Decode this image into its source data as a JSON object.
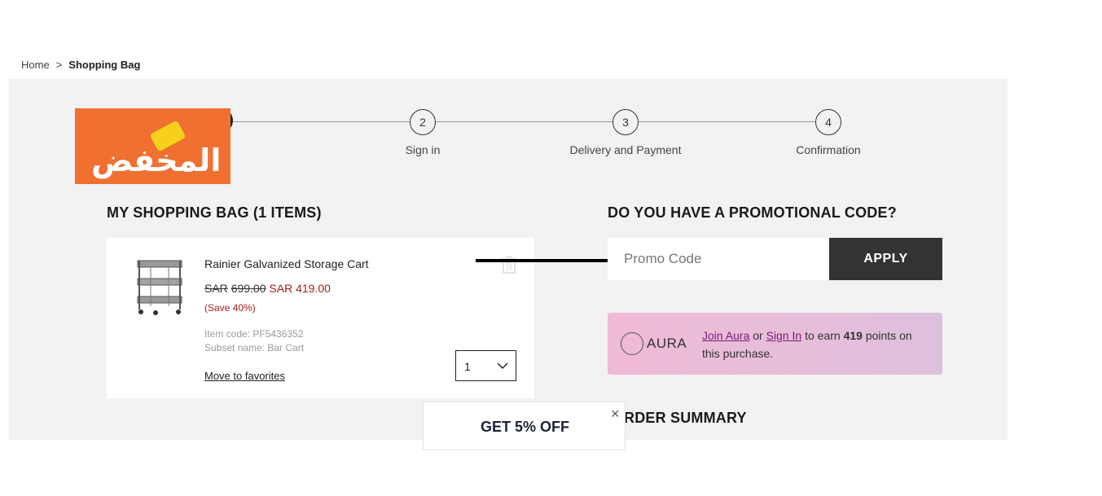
{
  "breadcrumb": {
    "home": "Home",
    "separator": ">",
    "current": "Shopping Bag"
  },
  "logo": {
    "text": "المخفض"
  },
  "steps": [
    {
      "number": "2",
      "label": "Sign in"
    },
    {
      "number": "3",
      "label": "Delivery and Payment"
    },
    {
      "number": "4",
      "label": "Confirmation"
    }
  ],
  "bag": {
    "title": "MY SHOPPING BAG (1 ITEMS)",
    "item": {
      "name": "Rainier Galvanized Storage Cart",
      "old_currency": "SAR",
      "old_price": "699.00",
      "new_currency": "SAR",
      "new_price": "419.00",
      "save": "(Save 40%)",
      "item_code": "Item code: PF5436352",
      "subset": "Subset name: Bar Cart",
      "move_to_favorites": "Move to favorites",
      "quantity": "1"
    }
  },
  "promo": {
    "title": "DO YOU HAVE A PROMOTIONAL CODE?",
    "placeholder": "Promo Code",
    "apply_label": "APPLY"
  },
  "aura": {
    "logo": "AURA",
    "join": "Join Aura",
    "or": "or",
    "signin": "Sign In",
    "to_earn": "to earn",
    "points": "419",
    "points_suffix": "points on this purchase."
  },
  "order_summary": {
    "title": "RDER SUMMARY"
  },
  "popup": {
    "title": "GET 5% OFF",
    "close": "×"
  },
  "colors": {
    "accent_dark": "#333333",
    "price_red": "#a41c1c",
    "logo_orange": "#f07032",
    "aura_pink": "#efbad6"
  }
}
